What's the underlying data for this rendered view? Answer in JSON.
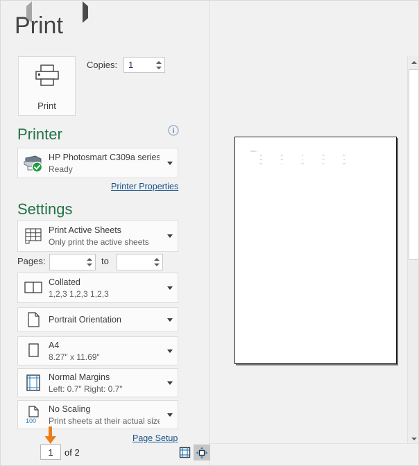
{
  "header": {
    "title": "Print"
  },
  "print_action": {
    "button_label": "Print",
    "icon": "printer-icon",
    "copies_label": "Copies:",
    "copies_value": "1"
  },
  "printer_section": {
    "heading": "Printer",
    "info_icon": "info-icon",
    "selected_printer": {
      "name": "HP Photosmart C309a series",
      "status": "Ready",
      "icon": "printer-status-icon",
      "badge": "green-check-badge"
    },
    "properties_link": "Printer Properties"
  },
  "settings_section": {
    "heading": "Settings",
    "items": [
      {
        "id": "print-what",
        "icon": "active-sheets-icon",
        "title": "Print Active Sheets",
        "subtitle": "Only print the active sheets"
      },
      {
        "id": "collation",
        "icon": "collated-icon",
        "title": "Collated",
        "subtitle": "1,2,3   1,2,3   1,2,3"
      },
      {
        "id": "orientation",
        "icon": "portrait-page-icon",
        "title": "Portrait Orientation",
        "subtitle": ""
      },
      {
        "id": "paper-size",
        "icon": "paper-size-icon",
        "title": "A4",
        "subtitle": "8.27\" x 11.69\""
      },
      {
        "id": "margins",
        "icon": "margins-icon",
        "title": "Normal Margins",
        "subtitle": "Left:  0.7\"   Right:  0.7\""
      },
      {
        "id": "scaling",
        "icon": "scaling-100-icon",
        "title": "No Scaling",
        "subtitle": "Print sheets at their actual size",
        "icon_text": "100"
      }
    ],
    "pages_label": "Pages:",
    "pages_from_value": "",
    "pages_to_label": "to",
    "pages_to_value": "",
    "page_setup_link": "Page Setup"
  },
  "preview": {
    "sheet_caption": "Table 1",
    "sheet_rows": [
      [
        "40",
        "58",
        "11",
        "29",
        "94"
      ],
      [
        "49",
        "44",
        "3",
        "53",
        "8"
      ],
      [
        "48",
        "4",
        "38",
        "51",
        "88"
      ]
    ]
  },
  "statusbar": {
    "prev_icon": "previous-page-arrow-icon",
    "next_icon": "next-page-arrow-icon",
    "current_page": "1",
    "total_pages_label": "of 2",
    "show_margins_icon": "show-margins-icon",
    "zoom_to_page_icon": "zoom-to-page-icon"
  },
  "scrollbar": {
    "up_icon": "scroll-up-arrow-icon",
    "down_icon": "scroll-down-arrow-icon",
    "thumb": "scroll-thumb"
  },
  "colors": {
    "accent_green": "#217346",
    "link_blue": "#17518a",
    "annotation_orange": "#ED7D1B",
    "icon_blue": "#1f7fc4",
    "status_green": "#1e9e3e"
  }
}
